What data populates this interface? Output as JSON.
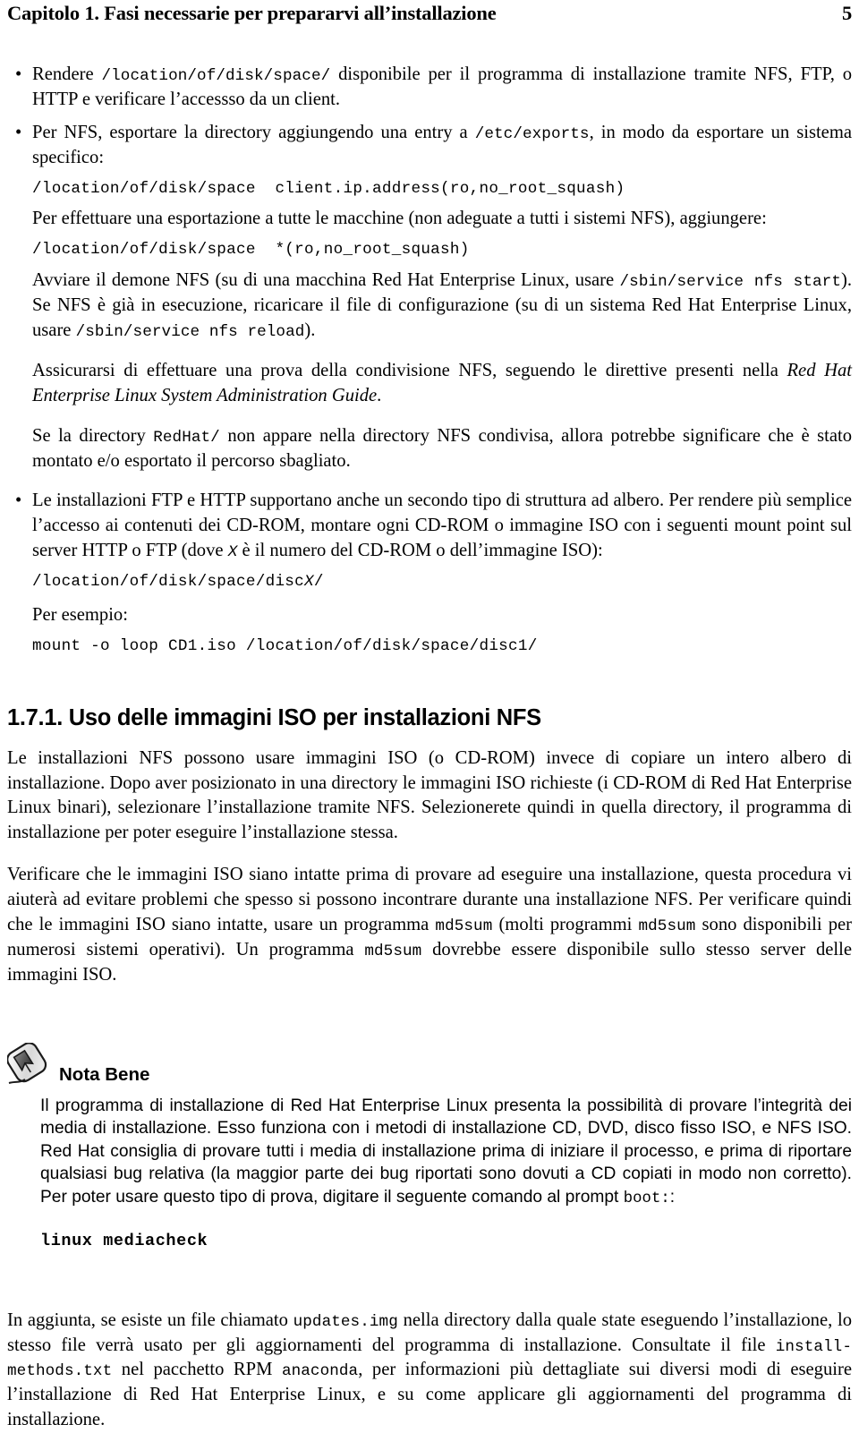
{
  "header": {
    "chapter_title": "Capitolo 1. Fasi necessarie per prepararvi all’installazione",
    "page_number": "5"
  },
  "bullets": [
    {
      "id": "bullet-disk-space",
      "text_before": "Rendere ",
      "code_inline": "/location/of/disk/space/",
      "text_after": " disponibile per il programma di installazione tramite NFS, FTP, o HTTP e verificare l’accessso da un client."
    },
    {
      "id": "bullet-nfs-export",
      "text_before": "Per NFS, esportare la directory aggiungendo una entry a ",
      "code_inline": "/etc/exports",
      "text_after": ", in modo da esportare un sistema specifico:",
      "code_block_1": "/location/of/disk/space  client.ip.address(ro,no_root_squash)",
      "para_2": "Per effettuare una esportazione a tutte le macchine (non adeguate a tutti i sistemi NFS), aggiungere:",
      "code_block_2": "/location/of/disk/space  *(ro,no_root_squash)",
      "para_3_a": "Avviare il demone NFS (su di una macchina Red Hat Enterprise Linux, usare ",
      "para_3_code_a": "/sbin/service nfs start",
      "para_3_b": "). Se NFS è già in esecuzione, ricaricare il file di configurazione (su di un sistema Red Hat Enterprise Linux, usare ",
      "para_3_code_b": "/sbin/service nfs reload",
      "para_3_c": ").",
      "para_4_a": "Assicurarsi di effettuare una prova della condivisione NFS, seguendo le direttive presenti nella ",
      "para_4_italic": "Red Hat Enterprise Linux System Administration Guide",
      "para_4_b": ".",
      "para_5_a": "Se la directory ",
      "para_5_code": "RedHat/",
      "para_5_b": " non appare nella directory NFS condivisa, allora potrebbe significare che è stato montato e/o esportato il percorso sbagliato."
    },
    {
      "id": "bullet-ftp-http",
      "text_a": "Le installazioni FTP e HTTP supportano anche un secondo tipo di struttura ad albero. Per rendere più semplice l’accesso ai contenuti dei CD-ROM, montare ogni CD-ROM o immagine ISO con i seguenti mount point sul server HTTP o FTP (dove ",
      "var_x": "X",
      "text_b": " è il numero del CD-ROM o dell’immagine ISO):",
      "code_block_1_pre": "/location/of/disk/space/disc",
      "code_block_1_var": "X",
      "code_block_1_post": "/",
      "para_example_label": "Per esempio:",
      "code_block_2": "mount -o loop CD1.iso /location/of/disk/space/disc1/"
    }
  ],
  "section": {
    "heading": "1.7.1. Uso delle immagini ISO per installazioni NFS",
    "para_1": "Le installazioni NFS possono usare immagini ISO (o CD-ROM) invece di copiare un intero albero di installazione. Dopo aver posizionato in una directory le immagini ISO richieste (i CD-ROM di Red Hat Enterprise Linux binari), selezionare l’installazione tramite NFS. Selezionerete quindi in quella directory, il programma di installazione per poter eseguire l’installazione stessa.",
    "para_2_a": "Verificare che le immagini ISO siano intatte prima di provare ad eseguire una installazione, questa procedura vi aiuterà ad evitare problemi che spesso si possono incontrare durante una installazione NFS. Per verificare quindi che le immagini ISO siano intatte, usare un programma ",
    "para_2_code_1": "md5sum",
    "para_2_b": " (molti programmi ",
    "para_2_code_2": "md5sum",
    "para_2_c": " sono disponibili per numerosi sistemi operativi). Un programma ",
    "para_2_code_3": "md5sum",
    "para_2_d": " dovrebbe essere disponibile sullo stesso server delle immagini ISO."
  },
  "note": {
    "icon_name": "note-pencil-icon",
    "title": "Nota Bene",
    "body_a": "Il programma di installazione di Red Hat Enterprise Linux presenta la possibilità di provare l’integrità dei media di installazione. Esso funziona con i metodi di installazione CD, DVD, disco fisso ISO, e NFS ISO. Red Hat consiglia di provare tutti i media di installazione prima di iniziare il processo, e prima di riportare qualsiasi bug relativa (la maggior parte dei bug riportati sono dovuti a CD copiati in modo non corretto). Per poter usare questo tipo di prova, digitare il seguente comando al prompt ",
    "body_code": "boot:",
    "body_b": ":",
    "command": "linux mediacheck"
  },
  "footer_para": {
    "text_a": "In aggiunta, se esiste un file chiamato ",
    "code_1": "updates.img",
    "text_b": " nella directory dalla quale state eseguendo l’installazione, lo stesso file verrà usato per gli aggiornamenti del programma di installazione. Consultate il file ",
    "code_2": "install-methods.txt",
    "text_c": " nel pacchetto RPM ",
    "code_3": "anaconda",
    "text_d": ", per informazioni più dettagliate sui diversi modi di eseguire l’installazione di Red Hat Enterprise Linux, e su come applicare gli aggiornamenti del programma di installazione."
  },
  "colors": {
    "text": "#000000",
    "page_bg": "#ffffff",
    "icon_grey": "#b9b9b9"
  }
}
